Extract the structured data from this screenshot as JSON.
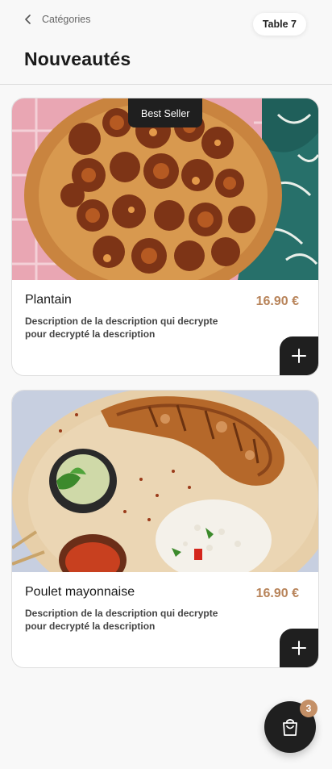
{
  "header": {
    "back_label": "Catégories",
    "table_label": "Table 7",
    "title": "Nouveautés"
  },
  "items": [
    {
      "badge": "Best Seller",
      "name": "Plantain",
      "price": "16.90 €",
      "description": "Description de la description qui decrypte pour decrypté la description",
      "image_icon": "fried-plantain-photo"
    },
    {
      "badge": "",
      "name": "Poulet mayonnaise",
      "price": "16.90 €",
      "description": "Description de la description qui decrypte pour decrypté la description",
      "image_icon": "grilled-chicken-rice-photo"
    }
  ],
  "cart": {
    "count": "3",
    "icon": "shopping-bag-icon"
  },
  "colors": {
    "accent_price": "#b8845a",
    "dark_button": "#1f1f1f",
    "badge_count_bg": "#c49067"
  }
}
